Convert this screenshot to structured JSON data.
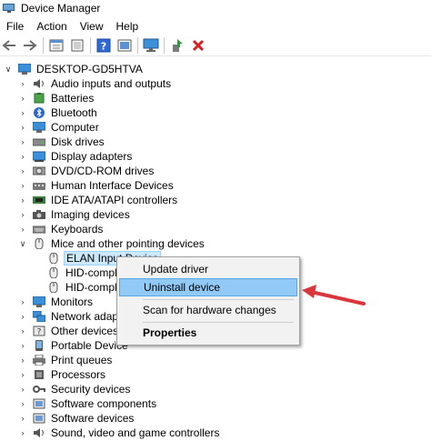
{
  "window": {
    "title": "Device Manager"
  },
  "menubar": [
    "File",
    "Action",
    "View",
    "Help"
  ],
  "toolbar": [
    "back-arrow-icon",
    "forward-arrow-icon",
    "properties-sheet-icon",
    "show-hidden-icon",
    "help-icon",
    "update-driver-icon",
    "scan-hardware-icon",
    "enable-device-icon",
    "uninstall-x-icon"
  ],
  "tree": {
    "root": "DESKTOP-GD5HTVA",
    "items": [
      "Audio inputs and outputs",
      "Batteries",
      "Bluetooth",
      "Computer",
      "Disk drives",
      "Display adapters",
      "DVD/CD-ROM drives",
      "Human Interface Devices",
      "IDE ATA/ATAPI controllers",
      "Imaging devices",
      "Keyboards",
      "Mice and other pointing devices",
      "ELAN Input Device",
      "HID-compli",
      "HID-compli",
      "Monitors",
      "Network adapte",
      "Other devices",
      "Portable Device",
      "Print queues",
      "Processors",
      "Security devices",
      "Software components",
      "Software devices",
      "Sound, video and game controllers"
    ]
  },
  "context_menu": {
    "update": "Update driver",
    "uninstall": "Uninstall device",
    "scan": "Scan for hardware changes",
    "properties": "Properties"
  },
  "colors": {
    "arrow": "#d9363e",
    "selection": "#cce8ff",
    "menu_highlight": "#91c9f7"
  }
}
